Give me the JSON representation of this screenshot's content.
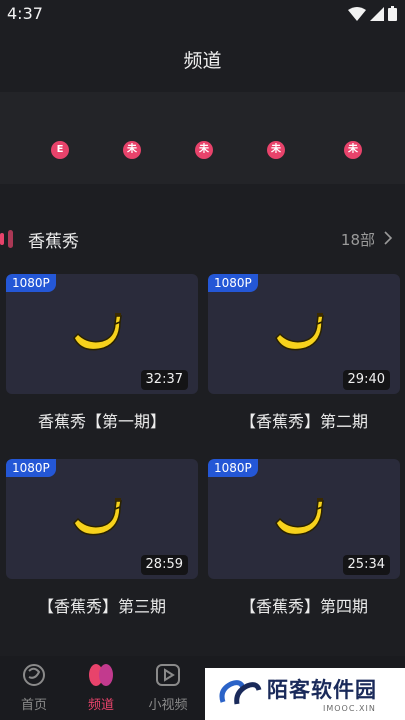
{
  "status": {
    "time": "4:37"
  },
  "page": {
    "title": "频道"
  },
  "filters": [
    {
      "label": "E"
    },
    {
      "label": "未"
    },
    {
      "label": "未"
    },
    {
      "label": "未"
    },
    {
      "label": "未"
    }
  ],
  "section": {
    "title": "香蕉秀",
    "count": "18部"
  },
  "videos": [
    {
      "quality": "1080P",
      "duration": "32:37",
      "title": "香蕉秀【第一期】"
    },
    {
      "quality": "1080P",
      "duration": "29:40",
      "title": "【香蕉秀】第二期"
    },
    {
      "quality": "1080P",
      "duration": "28:59",
      "title": "【香蕉秀】第三期"
    },
    {
      "quality": "1080P",
      "duration": "25:34",
      "title": "【香蕉秀】第四期"
    }
  ],
  "tabs": [
    {
      "label": "首页"
    },
    {
      "label": "频道"
    },
    {
      "label": "小视频"
    }
  ],
  "watermark": {
    "text": "陌客软件园",
    "sub": "IMOOC.XIN"
  },
  "colors": {
    "accent": "#e8436b",
    "badge": "#2457d6",
    "background": "#1d1e22"
  }
}
